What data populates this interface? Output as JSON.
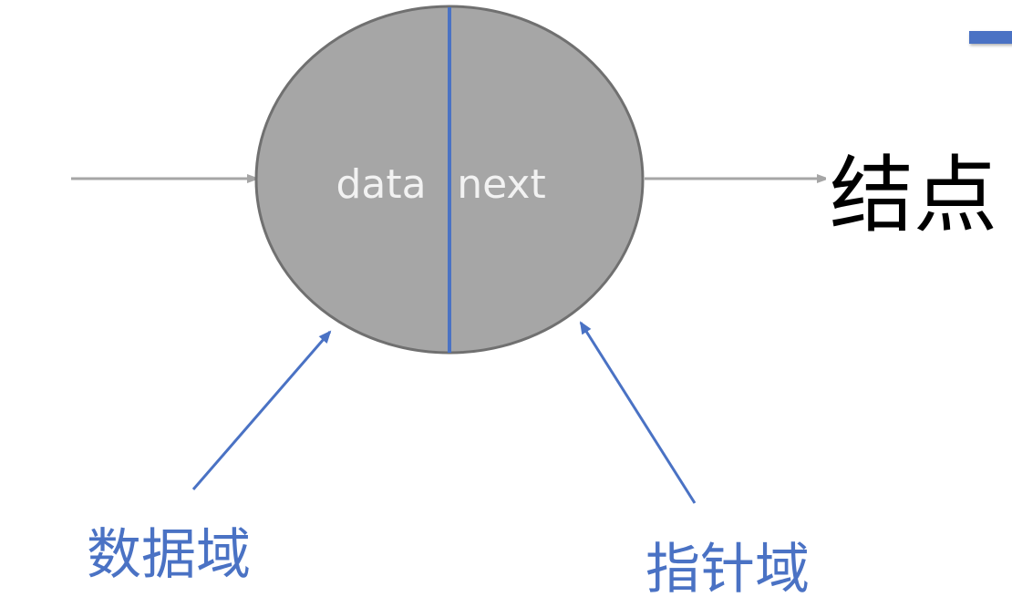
{
  "title": "结点",
  "node": {
    "data_label": "data",
    "next_label": "next"
  },
  "labels": {
    "data_field": "数据域",
    "pointer_field": "指针域"
  },
  "colors": {
    "accent": "#4a72c4",
    "node_fill": "#a6a6a6",
    "node_stroke": "#707070",
    "arrow_gray": "#a6a6a6"
  }
}
